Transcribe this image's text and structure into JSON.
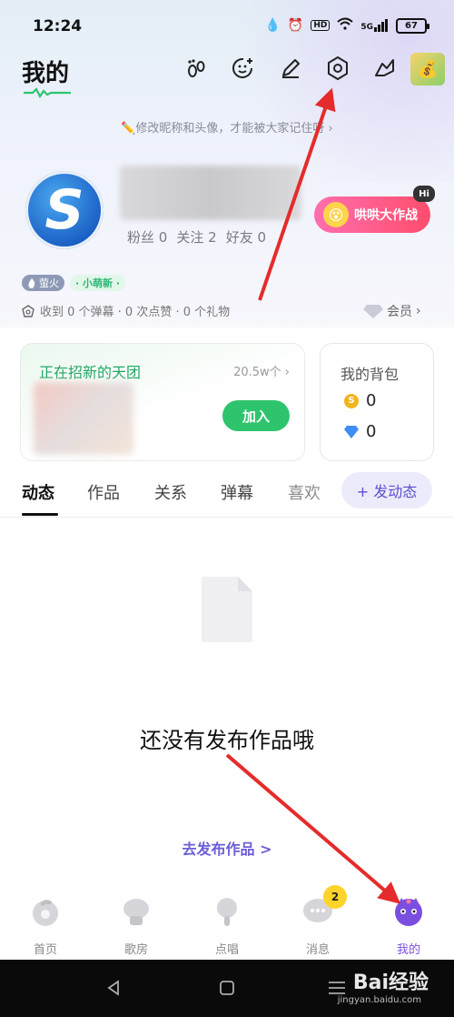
{
  "status_bar": {
    "time": "12:24",
    "signal": "5G",
    "hd": "HD",
    "battery": "67"
  },
  "header": {
    "title": "我的",
    "icons": [
      "footprint-icon",
      "emoji-add-icon",
      "edit-icon",
      "settings-icon",
      "share-icon"
    ]
  },
  "hint": "✏️修改昵称和头像，才能被大家记住呀 ›",
  "profile": {
    "fans_label": "粉丝",
    "fans": "0",
    "follow_label": "关注",
    "follow": "2",
    "friends_label": "好友",
    "friends": "0",
    "event_label": "哄哄大作战",
    "event_badge": "Hi",
    "tag_fire": "萤火",
    "tag_new": "· 小萌新 ·",
    "received": "收到 0 个弹幕 · 0 次点赞 · 0 个礼物",
    "member_label": "会员"
  },
  "team_card": {
    "title": "正在招新的天团",
    "count": "20.5w个 ›",
    "join_label": "加入"
  },
  "bag_card": {
    "title": "我的背包",
    "coins": "0",
    "diamonds": "0"
  },
  "tabs": [
    {
      "label": "动态"
    },
    {
      "label": "作品"
    },
    {
      "label": "关系"
    },
    {
      "label": "弹幕"
    },
    {
      "label": "喜欢"
    }
  ],
  "post_button": "+ 发动态",
  "empty": {
    "text": "还没有发布作品哦",
    "link": "去发布作品 >"
  },
  "bottom_nav": [
    {
      "label": "首页"
    },
    {
      "label": "歌房"
    },
    {
      "label": "点唱"
    },
    {
      "label": "消息"
    },
    {
      "label": "我的"
    }
  ],
  "message_badge": "2",
  "watermark": {
    "main": "Bai经验",
    "sub": "jingyan.baidu.com"
  },
  "colors": {
    "accent_green": "#2ec46e",
    "accent_purple": "#7a4fe0",
    "event_pink": "#ff4d6d",
    "arrow_red": "#e52b2b"
  }
}
